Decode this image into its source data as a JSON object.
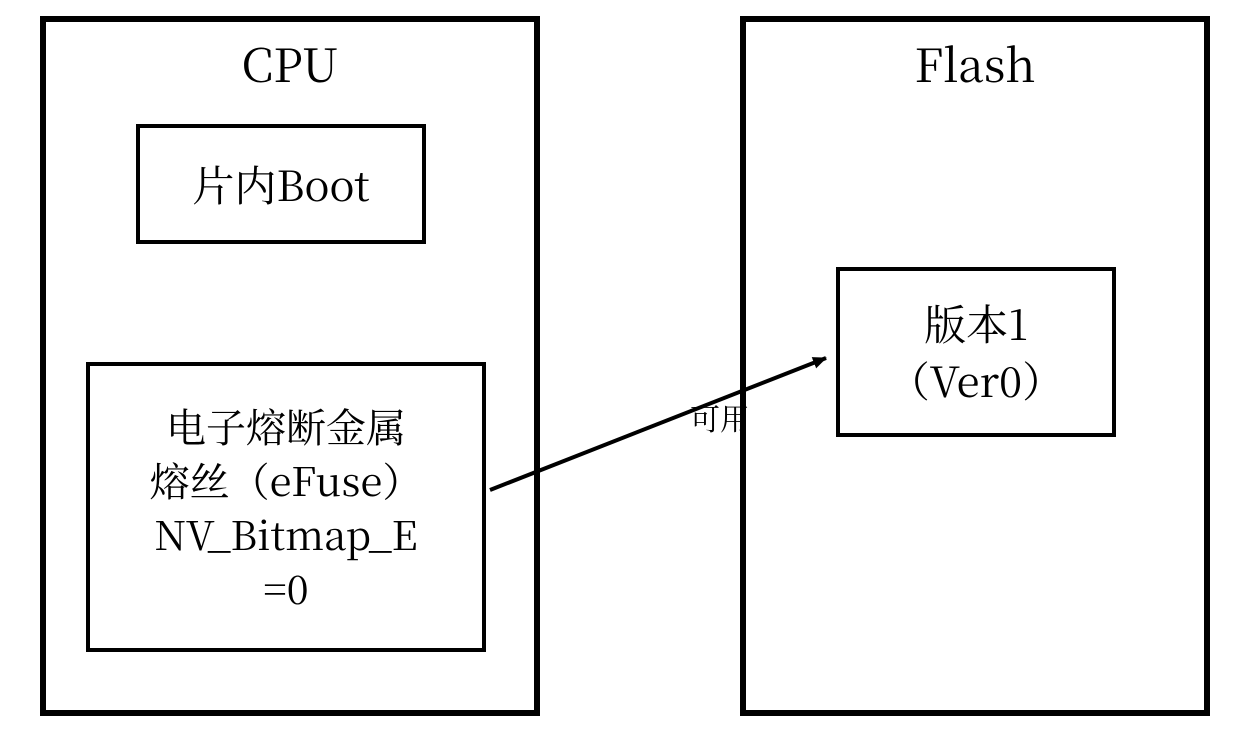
{
  "diagram": {
    "cpu": {
      "title": "CPU",
      "boot": "片内Boot",
      "efuse_line1": "电子熔断金属",
      "efuse_line2": "熔丝（eFuse）",
      "efuse_line3": "NV_Bitmap_E",
      "efuse_line4": "=0"
    },
    "flash": {
      "title": "Flash",
      "version_line1": "版本1",
      "version_line2": "（Ver0）"
    },
    "arrow_label": "可用"
  }
}
